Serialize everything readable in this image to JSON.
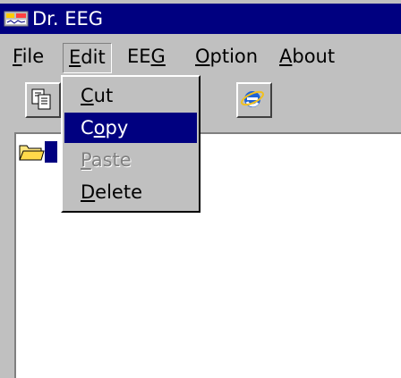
{
  "window": {
    "title": "Dr. EEG",
    "title_bar_color": "#000080"
  },
  "menubar": {
    "file": {
      "acc": "F",
      "rest": "ile"
    },
    "edit": {
      "acc": "E",
      "rest": "dit"
    },
    "eeg": {
      "pre": "EE",
      "acc": "G"
    },
    "option": {
      "acc": "O",
      "rest": "ption"
    },
    "about": {
      "acc": "A",
      "rest": "bout"
    }
  },
  "edit_menu": {
    "cut": {
      "acc": "C",
      "rest": "ut",
      "enabled": true
    },
    "copy": {
      "pre": "C",
      "acc": "o",
      "rest": "py",
      "enabled": true,
      "highlighted": true
    },
    "paste": {
      "acc": "P",
      "rest": "aste",
      "enabled": false
    },
    "delete": {
      "acc": "D",
      "rest": "elete",
      "enabled": true
    }
  },
  "toolbar": {
    "buttons": [
      "copy-icon",
      "internet-explorer-icon"
    ]
  },
  "tree": {
    "items": [
      "folder-icon"
    ]
  }
}
